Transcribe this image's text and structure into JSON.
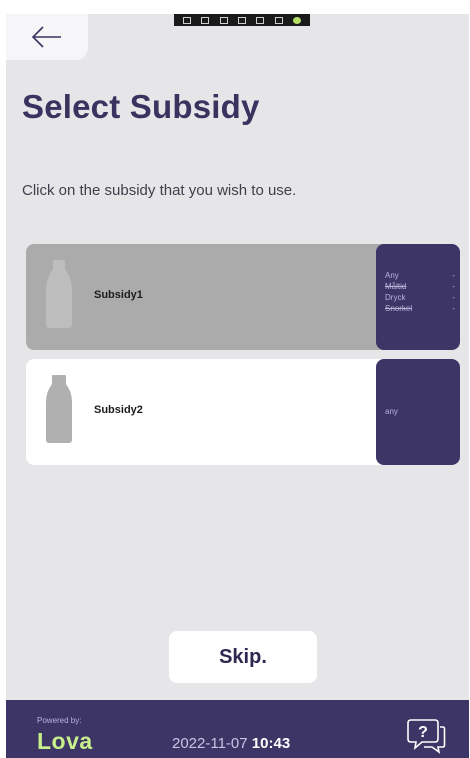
{
  "status_bar": {
    "icons": [
      "cast-icon",
      "screen-icon",
      "window-icon",
      "tablet-icon",
      "wifi-icon",
      "sync-icon",
      "check-icon"
    ]
  },
  "header": {
    "back_icon": "arrow-left-icon",
    "title": "Select Subsidy",
    "subtitle": "Click on the subsidy that you wish to use."
  },
  "subsidies": [
    {
      "name": "Subsidy1",
      "icon": "bottle-icon",
      "selected": false,
      "rows": [
        {
          "label": "Any",
          "value": "-",
          "struck": false
        },
        {
          "label": "Måltid",
          "value": "-",
          "struck": true
        },
        {
          "label": "Dryck",
          "value": "-",
          "struck": false
        },
        {
          "label": "Snorkel",
          "value": "-",
          "struck": true
        }
      ]
    },
    {
      "name": "Subsidy2",
      "icon": "bottle-icon",
      "selected": false,
      "side_text": "any"
    }
  ],
  "skip_label": "Skip.",
  "footer": {
    "powered_by": "Powered by:",
    "brand": "Lova",
    "date": "2022-11-07",
    "time": "10:43",
    "help_icon": "help-chat-icon"
  },
  "colors": {
    "background": "#e6e6e9",
    "accent": "#3d3566",
    "brand": "#c7ef8a",
    "card_selected": "#ababab"
  }
}
